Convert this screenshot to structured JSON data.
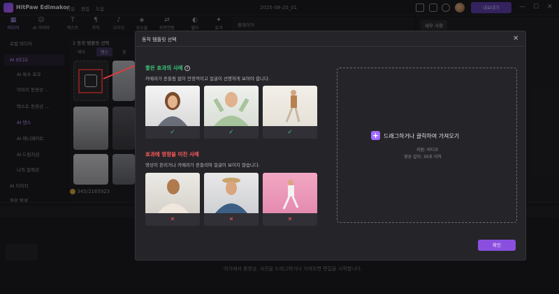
{
  "app": {
    "name": "HitPaw Edimakor",
    "menus": [
      "파일",
      "편집",
      "도움"
    ],
    "project": "2025-08-20_01",
    "export_label": "내보내기"
  },
  "toolbar": {
    "tools": [
      {
        "label": "미디어",
        "icon": "media-icon"
      },
      {
        "label": "AI 아바타",
        "icon": "avatar-icon"
      },
      {
        "label": "텍스트",
        "icon": "text-icon"
      },
      {
        "label": "자막",
        "icon": "subtitle-icon"
      },
      {
        "label": "오디오",
        "icon": "audio-icon"
      },
      {
        "label": "요소들",
        "icon": "elements-icon"
      },
      {
        "label": "화면전환",
        "icon": "transition-icon"
      },
      {
        "label": "필터",
        "icon": "filter-icon"
      },
      {
        "label": "효과",
        "icon": "effect-icon"
      }
    ]
  },
  "sidebar": {
    "items": [
      {
        "label": "로컬 미디어"
      },
      {
        "label": "AI 비디오"
      },
      {
        "label": "AI 특수 효과"
      },
      {
        "label": "이미지 동영상 ..."
      },
      {
        "label": "텍스트 동영상 ..."
      },
      {
        "label": "AI 댄스"
      },
      {
        "label": "AI 애니메이트"
      },
      {
        "label": "AI 드림지션"
      },
      {
        "label": "나의 컬렉션"
      },
      {
        "label": "AI 이미지"
      },
      {
        "label": "영감 탐색"
      }
    ]
  },
  "mid": {
    "step": "2",
    "heading": "동작 템플릿 선택",
    "tabs": [
      "메이",
      "댄스",
      "춤"
    ],
    "credits": "345/2165923"
  },
  "player": {
    "title": "플레이어"
  },
  "right": {
    "tab": "세부 사항"
  },
  "timeline": {
    "hint": "여기에서 동영상, 사진을 드래그하거나 가져오면 편집을 시작합니다."
  },
  "modal": {
    "title": "동작 템플릿 선택",
    "good_title": "좋은 효과의 사례",
    "good_desc": "카메라가 흔들림 없이 안정적이고 얼굴이 선명하게 보여야 합니다.",
    "bad_title": "효과에 영향을 미친 사례",
    "bad_desc": "영상이 흔리거나 카메라가 흔들리며 얼굴이 보이지 않습니다.",
    "drop_label": "드래그하거나 클릭하여 가져오기",
    "drop_support": "지원: 비디오",
    "drop_length": "영상 길이: 30초 이하",
    "ok_label": "확인",
    "good_mark": "✓",
    "bad_mark": "✕"
  },
  "colors": {
    "accent": "#8b4fe0",
    "good": "#3ec57a",
    "bad": "#ff5b5b",
    "highlight": "#e33b3b"
  }
}
